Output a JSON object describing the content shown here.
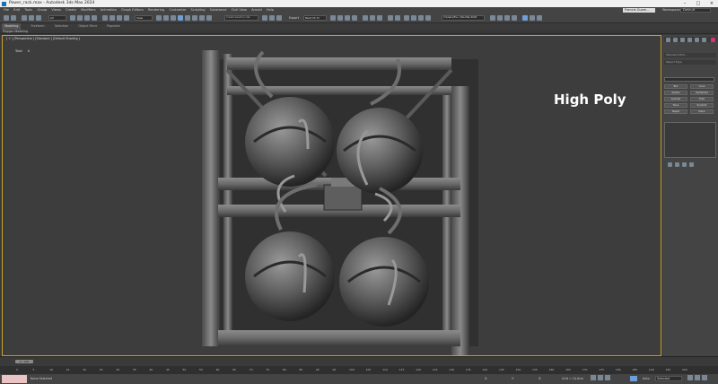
{
  "window": {
    "title": "Power_rack.max - Autodesk 3ds Max 2024",
    "sign_in": "Francis Gusm...",
    "workspace_label": "Workspaces :",
    "workspace_value": "Default"
  },
  "menu": [
    "File",
    "Edit",
    "Tools",
    "Group",
    "Views",
    "Create",
    "Modifiers",
    "Animation",
    "Graph Editors",
    "Rendering",
    "Customize",
    "Scripting",
    "Substance",
    "Civil View",
    "Arnold",
    "Help"
  ],
  "toolbar": {
    "filter_value": "All",
    "view_value": "View",
    "selection_set_placeholder": "Create Selection Set",
    "export_label": "Export",
    "render_preset": "Mesh fdr Pr",
    "workspace_scene": "C:\\Users\\Fra...\\3ds Max 2024"
  },
  "ribbon": {
    "tabs": [
      "Modeling",
      "Freeform",
      "Selection",
      "Object Paint",
      "Populate"
    ],
    "active_tab": "Modeling",
    "sub_label": "Polygon Modeling"
  },
  "viewport": {
    "label": "[ + ] [Perspective ] [Standard ] [Default Shading ]",
    "stats_label": "Total",
    "stats_value": "0",
    "overlay_text": "High Poly"
  },
  "command_panel": {
    "rollout": "Standard Prim...",
    "object_type": "Object Type",
    "buttons": [
      "Box",
      "Cone",
      "Sphere",
      "GeoSphere",
      "Cylinder",
      "Tube",
      "Torus",
      "Pyramid",
      "Teapot",
      "Plane"
    ]
  },
  "timeline": {
    "frame": "0 / 100",
    "ticks": [
      "0",
      "5",
      "10",
      "15",
      "20",
      "25",
      "30",
      "35",
      "40",
      "45",
      "50",
      "55",
      "60",
      "65",
      "70",
      "75",
      "80",
      "85",
      "90",
      "95",
      "100",
      "105",
      "110",
      "115",
      "120",
      "125",
      "130",
      "135",
      "140",
      "145",
      "150",
      "155",
      "160",
      "165",
      "170",
      "175",
      "180",
      "185",
      "190",
      "195",
      "200"
    ]
  },
  "status": {
    "selection": "None Selected",
    "grid": "Grid = 10.0cm",
    "x_label": "X:",
    "y_label": "Y:",
    "z_label": "Z:",
    "auto": "Auto",
    "selected": "Selected"
  }
}
